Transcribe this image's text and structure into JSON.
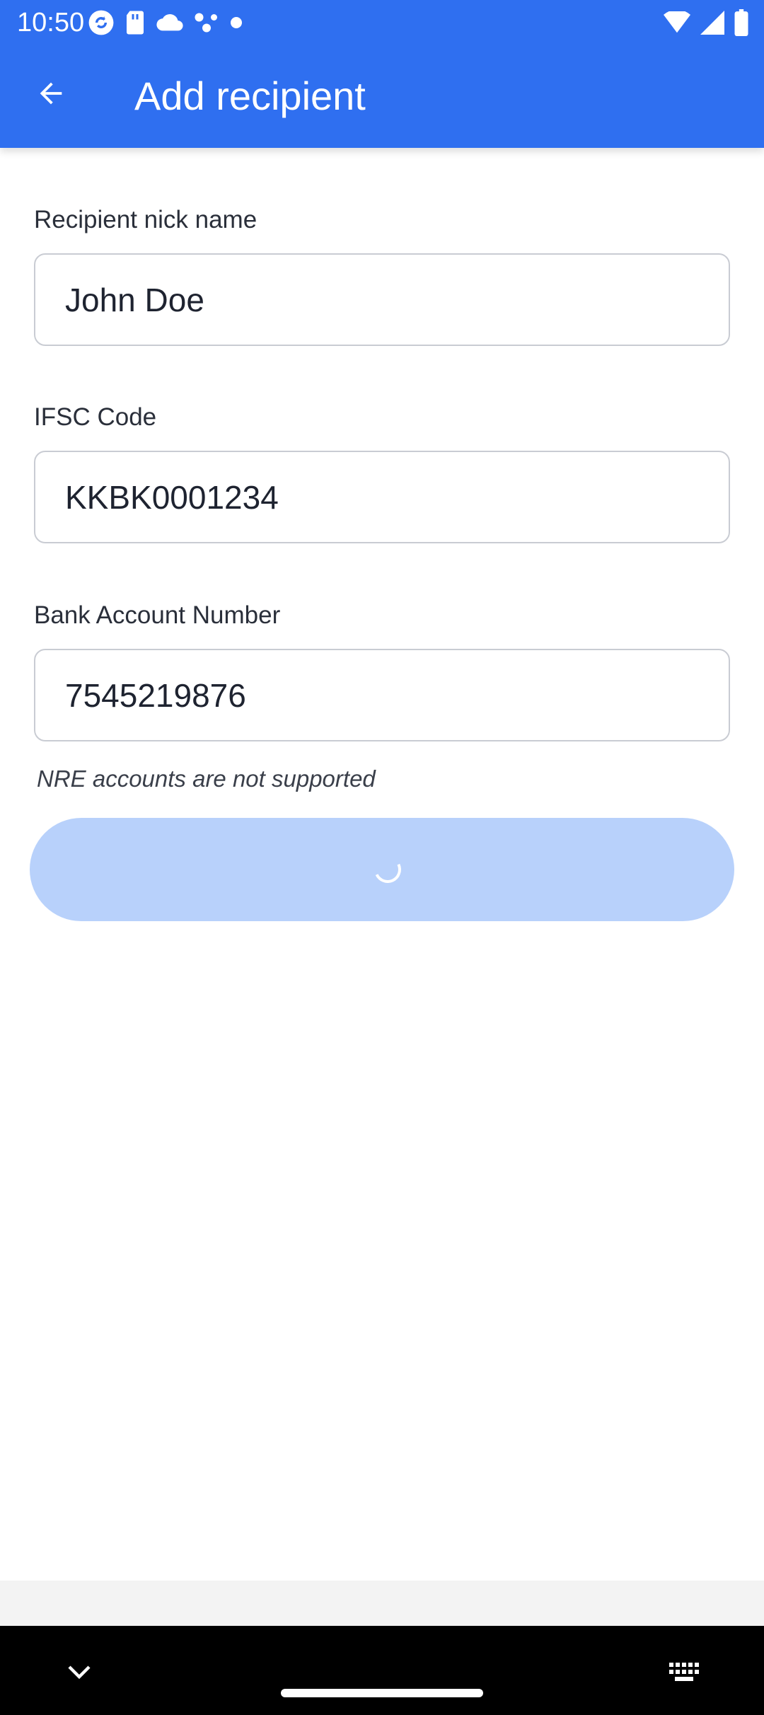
{
  "status_bar": {
    "time": "10:50",
    "left_icons": [
      "sync-icon",
      "sd-card-icon",
      "cloud-icon",
      "network-dots-icon",
      "dot-icon"
    ],
    "right_icons": [
      "wifi-icon",
      "signal-icon",
      "battery-icon"
    ]
  },
  "app_bar": {
    "title": "Add recipient",
    "back_icon": "arrow-back-icon",
    "background_color": "#2f6ff0"
  },
  "form": {
    "nickname": {
      "label": "Recipient nick name",
      "value": "John Doe"
    },
    "ifsc": {
      "label": "IFSC Code",
      "value": "KKBK0001234"
    },
    "account": {
      "label": "Bank Account Number",
      "value": "7545219876"
    },
    "hint": "NRE accounts are not supported",
    "submit": {
      "state": "loading",
      "icon": "spinner-icon",
      "color": "#b8d1fb"
    }
  },
  "nav_bar": {
    "icons": [
      "chevron-down-icon",
      "home-pill",
      "keyboard-icon"
    ]
  }
}
